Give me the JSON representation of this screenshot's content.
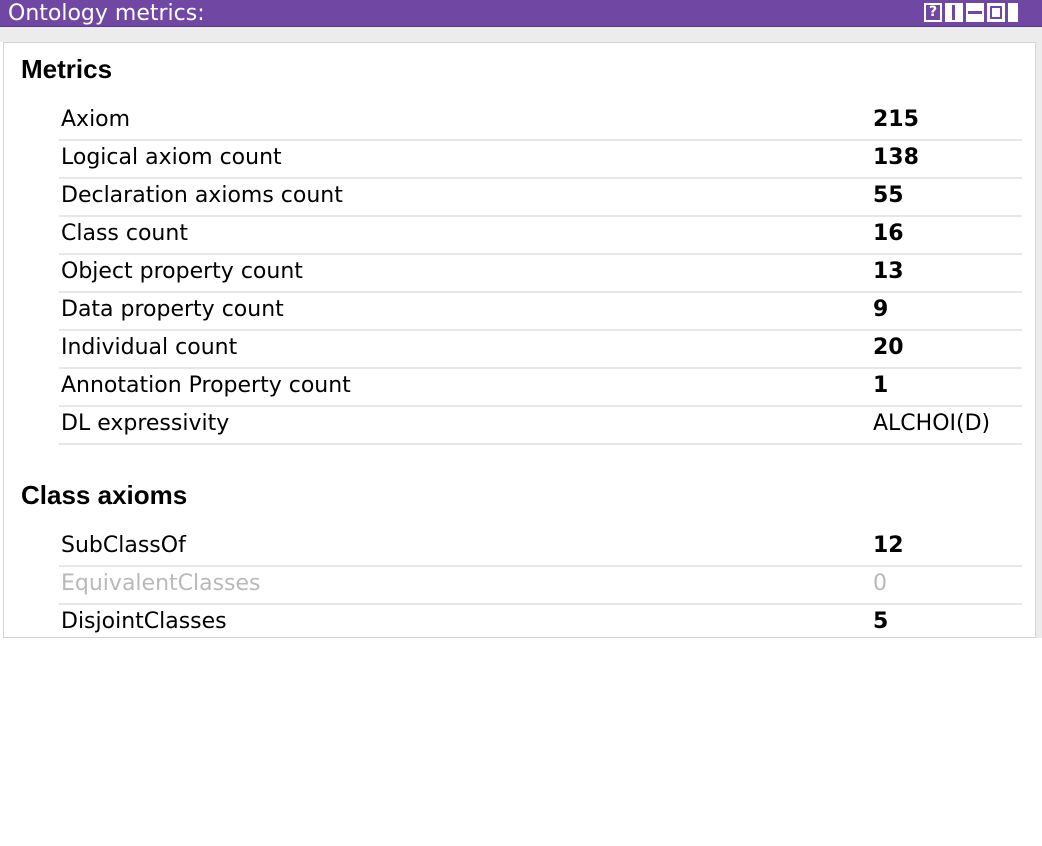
{
  "window": {
    "title": "Ontology metrics:",
    "buttons": {
      "help": "?"
    }
  },
  "sections": [
    {
      "heading": "Metrics",
      "rows": [
        {
          "label": "Axiom",
          "value": "215"
        },
        {
          "label": "Logical axiom count",
          "value": "138"
        },
        {
          "label": "Declaration axioms count",
          "value": "55"
        },
        {
          "label": "Class count",
          "value": "16"
        },
        {
          "label": "Object property count",
          "value": "13"
        },
        {
          "label": "Data property count",
          "value": "9"
        },
        {
          "label": "Individual count",
          "value": "20"
        },
        {
          "label": "Annotation Property count",
          "value": "1"
        },
        {
          "label": "DL expressivity",
          "value": "ALCHOI(D)"
        }
      ]
    },
    {
      "heading": "Class axioms",
      "rows": [
        {
          "label": "SubClassOf",
          "value": "12"
        },
        {
          "label": "EquivalentClasses",
          "value": "0"
        },
        {
          "label": "DisjointClasses",
          "value": "5"
        }
      ]
    }
  ],
  "colors": {
    "titlebar": "#7047a3",
    "muted_text": "#b9b9b9",
    "row_divider": "#e6e6e6"
  }
}
